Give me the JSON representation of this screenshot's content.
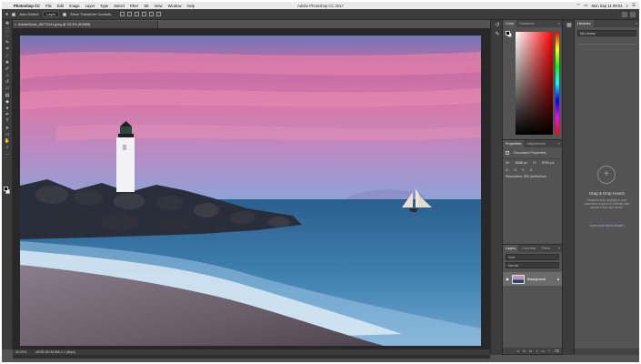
{
  "menubar": {
    "app_name": "Photoshop CC",
    "items": [
      "File",
      "Edit",
      "Image",
      "Layer",
      "Type",
      "Select",
      "Filter",
      "3D",
      "View",
      "Window",
      "Help"
    ],
    "window_title": "Adobe Photoshop CC 2017",
    "clock": "Mon Sep 11  09:01"
  },
  "options_bar": {
    "auto_select_label": "Auto-Select:",
    "auto_select_value": "Layer",
    "show_transform_label": "Show Transform Controls"
  },
  "document": {
    "tab_title": "AdobeStock_86772341.jpeg @ 33.3% (RGB/8)",
    "zoom": "33.33%",
    "doc_info": "sRGB IEC61966-2.1 (8bpc)"
  },
  "color_panel": {
    "tabs": [
      "Color",
      "Swatches"
    ]
  },
  "properties_panel": {
    "tabs": [
      "Properties",
      "Adjustments"
    ],
    "header": "Document Properties",
    "w_label": "W:",
    "w_value": "8688 px",
    "h_label": "H:",
    "h_value": "5792 px",
    "x_label": "X:",
    "x_value": "0",
    "y_label": "Y:",
    "y_value": "0",
    "resolution": "Resolution: 300 pixels/inch"
  },
  "layers_panel": {
    "tabs": [
      "Layers",
      "Channels",
      "Paths"
    ],
    "kind_filter": "Kind",
    "blend_mode": "Normal",
    "layer_name": "Background"
  },
  "libraries_panel": {
    "tab": "Libraries",
    "library_name": "My Library",
    "dd_title": "Drag & Drop Assets",
    "dd_text": "Drag and drop anything in your document to add it to Libraries and access it from any device.",
    "dd_link": "Learn more about Libraries"
  },
  "colors": {
    "app_bg": "#535353",
    "panel_dark": "#3c3c3c",
    "canvas_bg": "#282828",
    "selected_layer": "#6b6b6b"
  }
}
